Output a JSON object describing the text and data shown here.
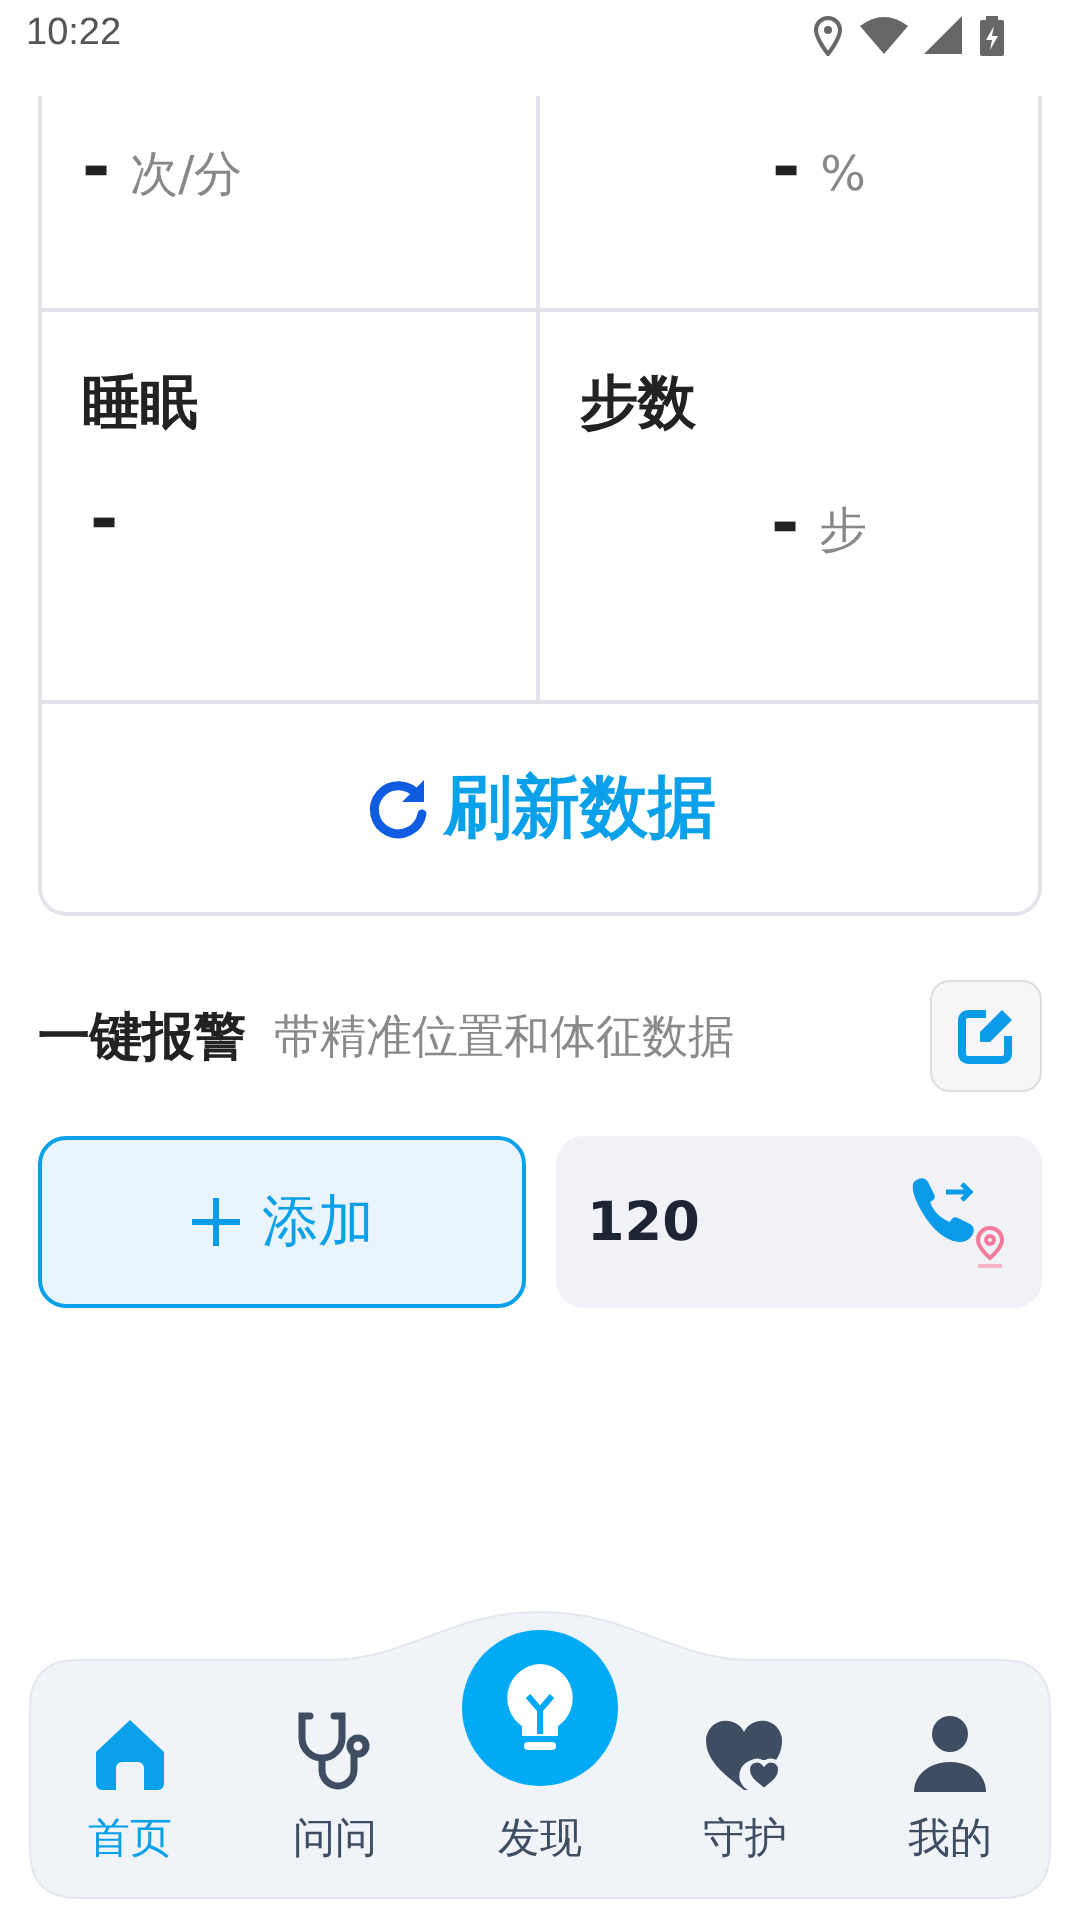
{
  "status_bar": {
    "time": "10:22"
  },
  "metrics": [
    {
      "value": "-",
      "unit": "次/分"
    },
    {
      "value": "-",
      "unit": "%"
    },
    {
      "label": "睡眠",
      "value": "-"
    },
    {
      "label": "步数",
      "value": "-",
      "unit": "步"
    }
  ],
  "refresh_button": {
    "label": "刷新数据"
  },
  "alarm": {
    "title": "一键报警",
    "subtitle": "带精准位置和体征数据"
  },
  "contacts": [
    {
      "kind": "add",
      "label": "添加"
    },
    {
      "kind": "number",
      "label": "120"
    }
  ],
  "nav": [
    {
      "kind": "home",
      "label": "首页",
      "selected": true
    },
    {
      "kind": "doctor",
      "label": "问问",
      "selected": false
    },
    {
      "kind": "discover",
      "label": "发现",
      "selected": false
    },
    {
      "kind": "guard",
      "label": "守护",
      "selected": false
    },
    {
      "kind": "me",
      "label": "我的",
      "selected": false
    }
  ]
}
